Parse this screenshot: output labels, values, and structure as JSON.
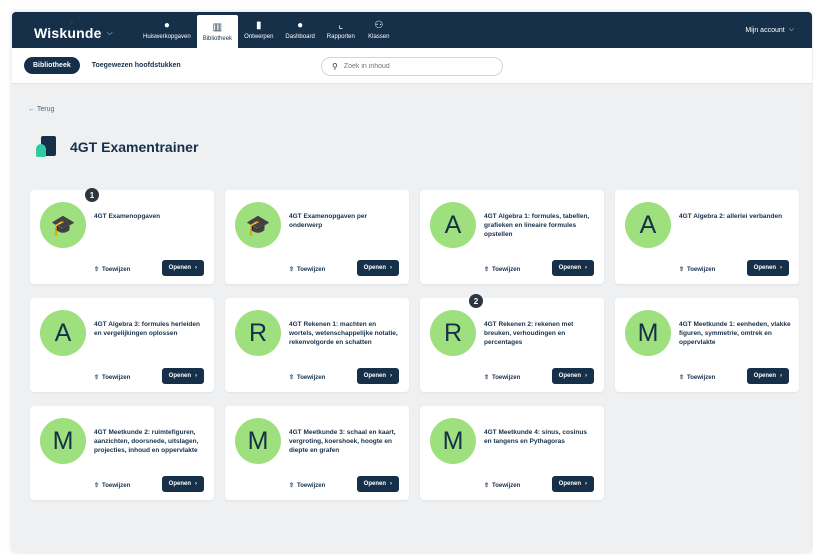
{
  "app": {
    "subtitle": "...",
    "title": "Wiskunde"
  },
  "nav": {
    "tabs": [
      {
        "label": "Huiswerkopgaven",
        "icon": "info-icon"
      },
      {
        "label": "Bibliotheek",
        "icon": "library-icon",
        "active": true
      },
      {
        "label": "Ontwerpen",
        "icon": "document-icon"
      },
      {
        "label": "Dashboard",
        "icon": "dashboard-icon"
      },
      {
        "label": "Rapporten",
        "icon": "chart-icon"
      },
      {
        "label": "Klassen",
        "icon": "users-icon"
      }
    ],
    "account": "Mijn account"
  },
  "subnav": {
    "library_pill": "Bibliotheek",
    "assigned_tab": "Toegewezen hoofdstukken",
    "search_placeholder": "Zoek in inhoud"
  },
  "back_label": "Terug",
  "page_title": "4GT Examentrainer",
  "card_actions": {
    "assign": "Toewijzen",
    "open": "Openen"
  },
  "cards": [
    {
      "letter": "",
      "icon": "graduate-owl",
      "title": "4GT Examenopgaven"
    },
    {
      "letter": "",
      "icon": "graduate-owl",
      "title": "4GT Examenopgaven per onderwerp"
    },
    {
      "letter": "A",
      "title": "4GT Algebra 1: formules, tabellen, grafieken en lineaire formules opstellen"
    },
    {
      "letter": "A",
      "title": "4GT Algebra 2: allerlei verbanden"
    },
    {
      "letter": "A",
      "title": "4GT Algebra 3: formules herleiden en vergelijkingen oplossen"
    },
    {
      "letter": "R",
      "title": "4GT Rekenen 1: machten en wortels, wetenschappelijke notatie, rekenvolgorde en schatten"
    },
    {
      "letter": "R",
      "title": "4GT Rekenen 2: rekenen met breuken, verhoudingen en percentages"
    },
    {
      "letter": "M",
      "title": "4GT Meetkunde 1: eenheden, vlakke figuren, symmetrie, omtrek en oppervlakte"
    },
    {
      "letter": "M",
      "title": "4GT Meetkunde 2: ruimtefiguren, aanzichten, doorsnede, uitslagen, projecties, inhoud en oppervlakte"
    },
    {
      "letter": "M",
      "title": "4GT Meetkunde 3: schaal en kaart, vergroting, koershoek, hoogte en diepte en grafen"
    },
    {
      "letter": "M",
      "title": "4GT Meetkunde 4: sinus, cosinus en tangens en Pythagoras"
    }
  ],
  "badges": [
    "1",
    "2"
  ],
  "colors": {
    "navy": "#16304a",
    "avatar_green": "#9fe07e",
    "accent_teal": "#2fcaa0"
  }
}
